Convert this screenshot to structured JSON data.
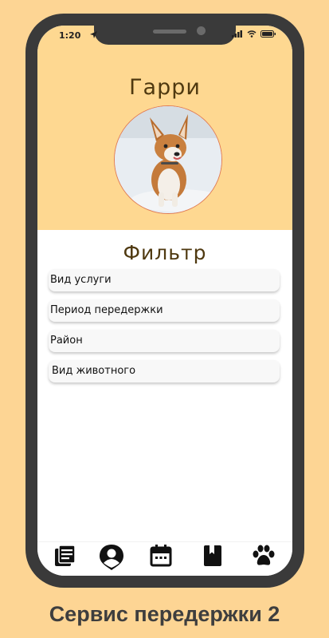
{
  "status_bar": {
    "time": "1:20",
    "icons": [
      "location-arrow-icon",
      "signal-icon",
      "wifi-icon",
      "battery-icon"
    ]
  },
  "profile": {
    "name": "Гарри"
  },
  "filter": {
    "title": "Фильтр",
    "items": [
      "Вид услуги",
      "Период передержки",
      "Район",
      "Вид животного"
    ]
  },
  "tab_bar": {
    "icons": [
      "news-list-icon",
      "profile-icon",
      "calendar-icon",
      "book-icon",
      "paw-icon"
    ]
  },
  "caption": "Сервис передержки 2",
  "colors": {
    "background": "#fdd594",
    "header": "#fed891",
    "phone": "#3a3a3a",
    "text_brown": "#4f3910"
  }
}
